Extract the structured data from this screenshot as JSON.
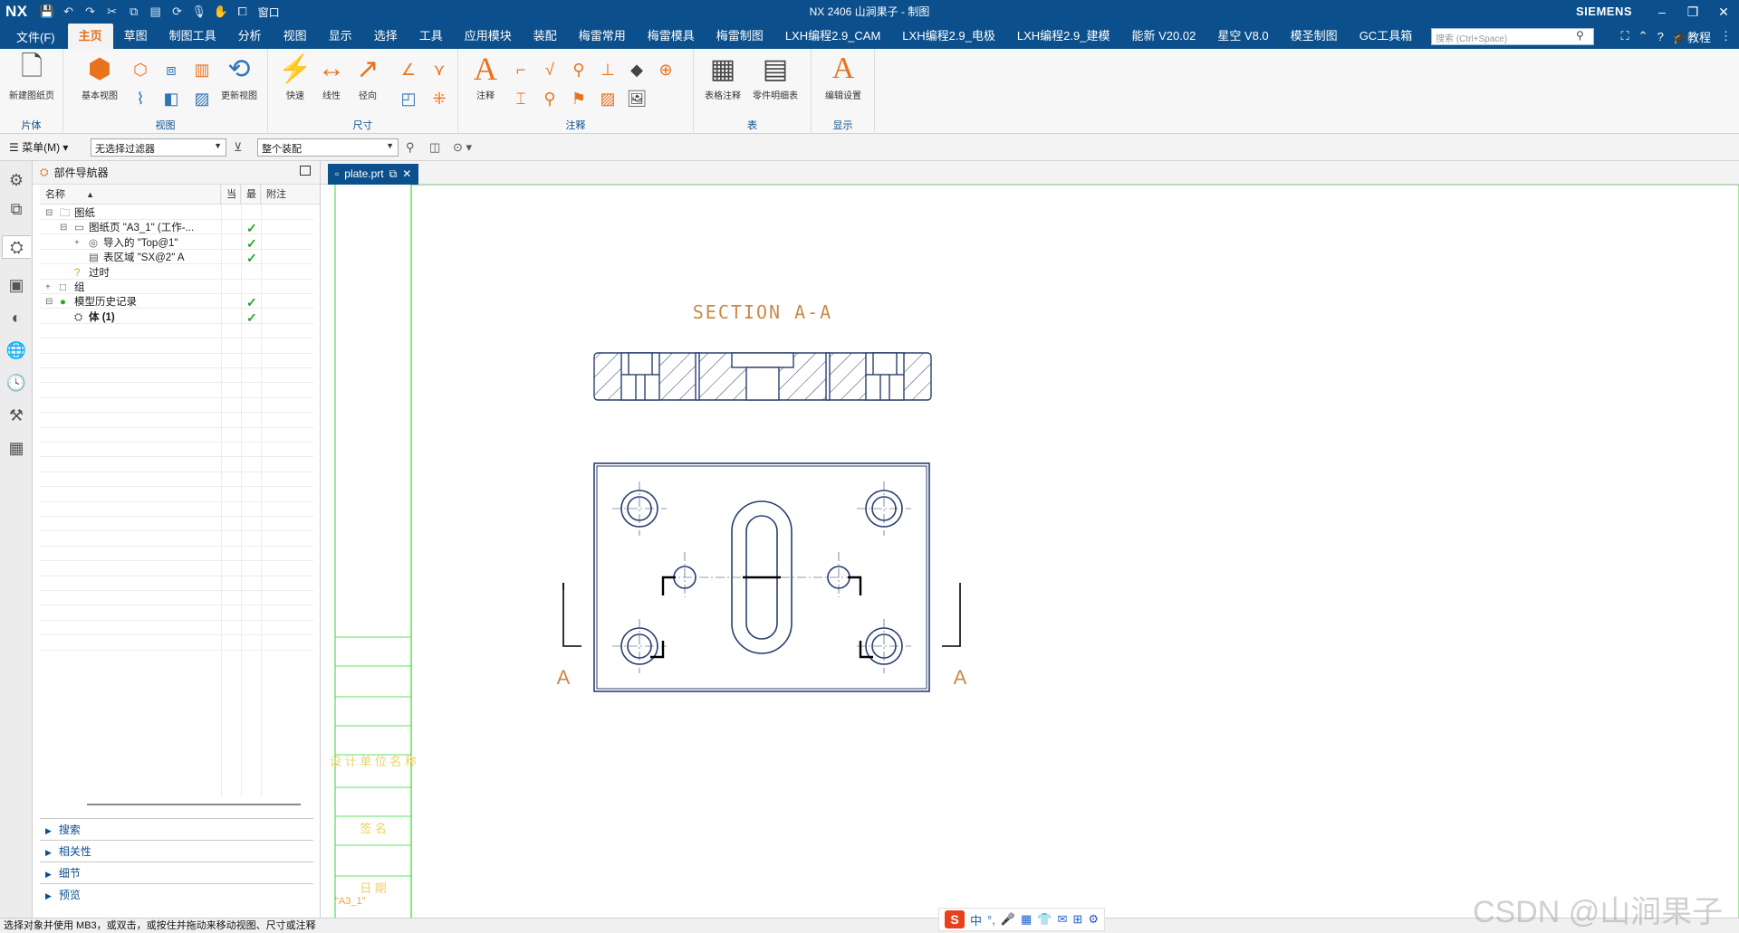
{
  "titlebar": {
    "logo": "NX",
    "window_menu": "窗口",
    "title": "NX 2406 山涧果子 - 制图",
    "brand": "SIEMENS"
  },
  "menubar": {
    "file": "文件(F)",
    "tabs": [
      "主页",
      "草图",
      "制图工具",
      "分析",
      "视图",
      "显示",
      "选择",
      "工具",
      "应用模块",
      "装配",
      "梅雷常用",
      "梅雷模具",
      "梅雷制图",
      "LXH编程2.9_CAM",
      "LXH编程2.9_电极",
      "LXH编程2.9_建模",
      "能新 V20.02",
      "星空 V8.0",
      "模圣制图",
      "GC工具箱"
    ],
    "active_tab": "主页",
    "search_placeholder": "搜索 (Ctrl+Space)",
    "tutorial": "教程"
  },
  "ribbon": {
    "groups": {
      "sheet": "片体",
      "view": "视图",
      "dimension": "尺寸",
      "annotation": "注释",
      "table": "表",
      "display": "显示"
    },
    "buttons": {
      "new_sheet": "新建图纸页",
      "base_view": "基本视图",
      "update_view": "更新视图",
      "rapid": "快速",
      "linear": "线性",
      "radial": "径向",
      "note": "注释",
      "tabular_note": "表格注释",
      "parts_list": "零件明细表",
      "edit_settings": "编辑设置"
    }
  },
  "toolbar2": {
    "menu": "菜单(M)",
    "filter": "无选择过滤器",
    "scope": "整个装配"
  },
  "navigator": {
    "title": "部件导航器",
    "columns": [
      "名称",
      "当",
      "最",
      "附注"
    ],
    "rows": [
      {
        "label": "图纸",
        "level": 0,
        "exp": "⊟",
        "check": ""
      },
      {
        "label": "图纸页 \"A3_1\" (工作-...",
        "level": 1,
        "exp": "⊟",
        "check": "✓"
      },
      {
        "label": "导入的 \"Top@1\"",
        "level": 2,
        "exp": "+",
        "check": "✓"
      },
      {
        "label": "表区域 \"SX@2\" A",
        "level": 2,
        "exp": "",
        "check": "✓"
      },
      {
        "label": "过时",
        "level": 1,
        "exp": "",
        "check": ""
      },
      {
        "label": "组",
        "level": 0,
        "exp": "+",
        "check": ""
      },
      {
        "label": "模型历史记录",
        "level": 0,
        "exp": "⊟",
        "check": "✓"
      },
      {
        "label": "体 (1)",
        "level": 1,
        "exp": "",
        "check": "✓"
      }
    ],
    "sections": [
      "搜索",
      "相关性",
      "细节",
      "预览"
    ]
  },
  "document": {
    "tab": "plate.prt",
    "sheet_name": "\"A3_1\"",
    "section_title": "SECTION  A-A",
    "section_marker_left": "A",
    "section_marker_right": "A",
    "title_block_text": [
      "设 计 单 位 名 称",
      "签 名",
      "日 期"
    ]
  },
  "status": {
    "message": "选择对象并使用 MB3，或双击，或按住并拖动来移动视图、尺寸或注释"
  },
  "ime": {
    "items": [
      "中",
      "°,",
      "🎤",
      "▦",
      "👕",
      "✉",
      "⊞",
      "⚙"
    ]
  },
  "watermark": "CSDN @山涧果子",
  "colors": {
    "titlebar": "#0b4f8c",
    "accent": "#e8731c",
    "drawing_line": "#2a3f6e",
    "border_green": "#33d633",
    "check_green": "#22a722"
  }
}
